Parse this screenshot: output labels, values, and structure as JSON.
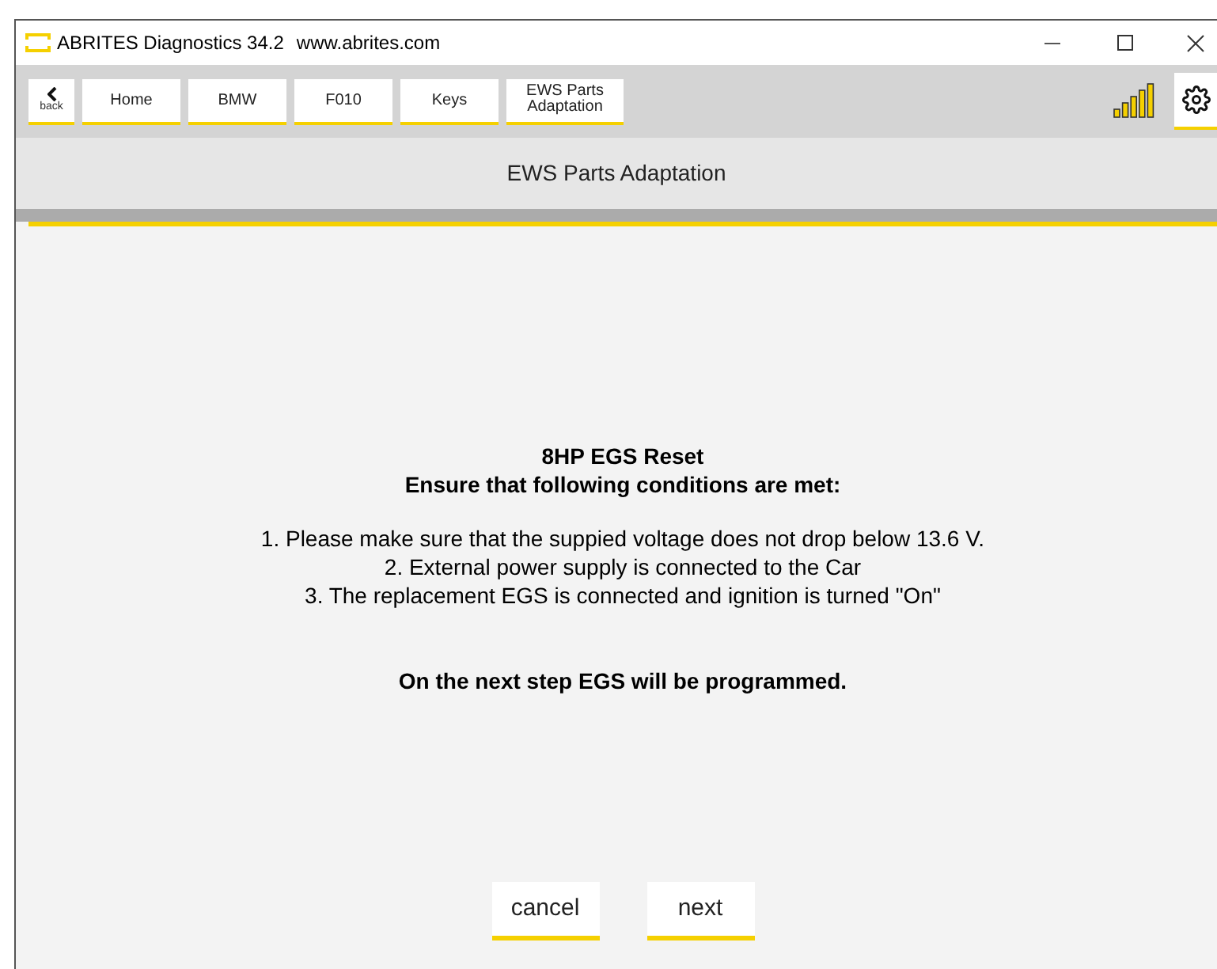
{
  "window": {
    "title": "ABRITES Diagnostics 34.2",
    "url": "www.abrites.com"
  },
  "toolbar": {
    "back": {
      "label": "back"
    },
    "breadcrumbs": [
      {
        "label": "Home"
      },
      {
        "label": "BMW"
      },
      {
        "label": "F010"
      },
      {
        "label": "Keys"
      },
      {
        "label": "EWS Parts Adaptation"
      }
    ]
  },
  "page_title": "EWS Parts Adaptation",
  "content": {
    "title": "8HP EGS Reset",
    "subtitle": "Ensure that following conditions are met:",
    "conditions": [
      "1. Please make sure that the suppied voltage does not drop below 13.6 V.",
      "2. External power supply is connected to the Car",
      "3. The replacement EGS is connected and ignition is turned \"On\""
    ],
    "warning": "On the next step EGS will be programmed."
  },
  "buttons": [
    {
      "label": "cancel"
    },
    {
      "label": "next"
    }
  ]
}
